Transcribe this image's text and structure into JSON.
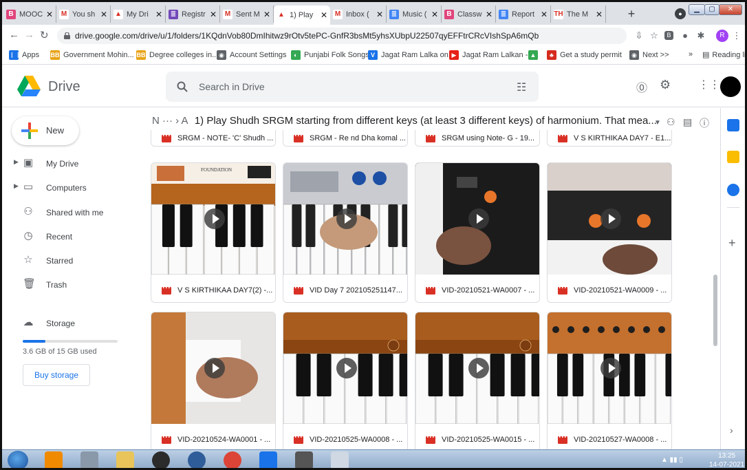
{
  "browser": {
    "tabs": [
      {
        "label": "MOOC",
        "color": "#e0457b",
        "glyph": "B",
        "active": false
      },
      {
        "label": "You sh",
        "color": "#ffffff",
        "glyph": "M",
        "active": false
      },
      {
        "label": "My Dri",
        "color": "#ffffff",
        "glyph": "▲",
        "active": false
      },
      {
        "label": "Registr",
        "color": "#7248b9",
        "glyph": "≣",
        "active": false
      },
      {
        "label": "Sent M",
        "color": "#ffffff",
        "glyph": "M",
        "active": false
      },
      {
        "label": "1) Play",
        "color": "#ffffff",
        "glyph": "▲",
        "active": true
      },
      {
        "label": "Inbox (",
        "color": "#ffffff",
        "glyph": "M",
        "active": false
      },
      {
        "label": "Music (",
        "color": "#4285f4",
        "glyph": "≣",
        "active": false
      },
      {
        "label": "Classw",
        "color": "#e0457b",
        "glyph": "B",
        "active": false
      },
      {
        "label": "Report",
        "color": "#4285f4",
        "glyph": "≣",
        "active": false
      },
      {
        "label": "The M",
        "color": "#ffffff",
        "glyph": "TH",
        "active": false
      }
    ],
    "url": "drive.google.com/drive/u/1/folders/1KQdnVob80DmIhitwz9rOtv5tePC-GnfR3bsMt5yhsXUbpU22507qyEFFtrCRcVIshSpA6mQb",
    "profile_letter": "R",
    "bookmarks": [
      {
        "label": "Apps",
        "color": "#1a73e8",
        "glyph": "⋮⋮"
      },
      {
        "label": "Government Mohin...",
        "color": "#e8a317",
        "glyph": "BB"
      },
      {
        "label": "Degree colleges in...",
        "color": "#e8a317",
        "glyph": "BB"
      },
      {
        "label": "Account Settings",
        "color": "#5f6368",
        "glyph": "◉"
      },
      {
        "label": "Punjabi Folk Songs...",
        "color": "#34a853",
        "glyph": "◐"
      },
      {
        "label": "Jagat Ram Lalka on...",
        "color": "#1a73e8",
        "glyph": "V"
      },
      {
        "label": "Jagat Ram Lalkan -...",
        "color": "#e62117",
        "glyph": "▶"
      },
      {
        "label": "",
        "color": "#34a853",
        "glyph": "▲"
      },
      {
        "label": "Get a study permit",
        "color": "#d52b1e",
        "glyph": "♣"
      },
      {
        "label": "Next >>",
        "color": "#5f6368",
        "glyph": "◉"
      }
    ],
    "bookmarks_overflow": "»",
    "reading_list": "Reading list"
  },
  "drive": {
    "title": "Drive",
    "search_placeholder": "Search in Drive",
    "new_label": "New",
    "nav": [
      {
        "label": "My Drive",
        "icon": "▣",
        "caret": true
      },
      {
        "label": "Computers",
        "icon": "▭",
        "caret": true
      },
      {
        "label": "Shared with me",
        "icon": "⚇",
        "caret": false
      },
      {
        "label": "Recent",
        "icon": "◷",
        "caret": false
      },
      {
        "label": "Starred",
        "icon": "☆",
        "caret": false
      },
      {
        "label": "Trash",
        "icon": "🗑",
        "caret": false
      }
    ],
    "storage_label": "Storage",
    "storage_used_fraction": 0.24,
    "storage_text": "3.6 GB of 15 GB used",
    "buy_storage": "Buy storage",
    "breadcrumb_prefix": "N ··· ›  A",
    "folder_title": "1) Play Shudh SRGM starting from different keys (at least 3 different keys) of harmonium. That mea...",
    "top_row": [
      "SRGM - NOTE- 'C' Shudh ...",
      "SRGM - Re nd Dha komal ...",
      "SRGM using Note- G - 19...",
      "V S KIRTHIKAA DAY7 - E1..."
    ],
    "files": [
      {
        "name": "V S KIRTHIKAA DAY7(2) -...",
        "thumb": "harmonium-ad"
      },
      {
        "name": "VID Day 7 202105251147...",
        "thumb": "keyboard-hand"
      },
      {
        "name": "VID-20210521-WA0007 - ...",
        "thumb": "black-keyboard"
      },
      {
        "name": "VID-20210521-WA0009 - ...",
        "thumb": "black-keyboard-2"
      },
      {
        "name": "VID-20210524-WA0001 - ...",
        "thumb": "harmonium-hand"
      },
      {
        "name": "VID-20210525-WA0008 - ...",
        "thumb": "harmonium-wood"
      },
      {
        "name": "VID-20210525-WA0015 - ...",
        "thumb": "harmonium-wood"
      },
      {
        "name": "VID-20210527-WA0008 - ...",
        "thumb": "harmonium-dots"
      }
    ]
  },
  "taskbar": {
    "time": "13:25",
    "date": "14-07-2021"
  }
}
